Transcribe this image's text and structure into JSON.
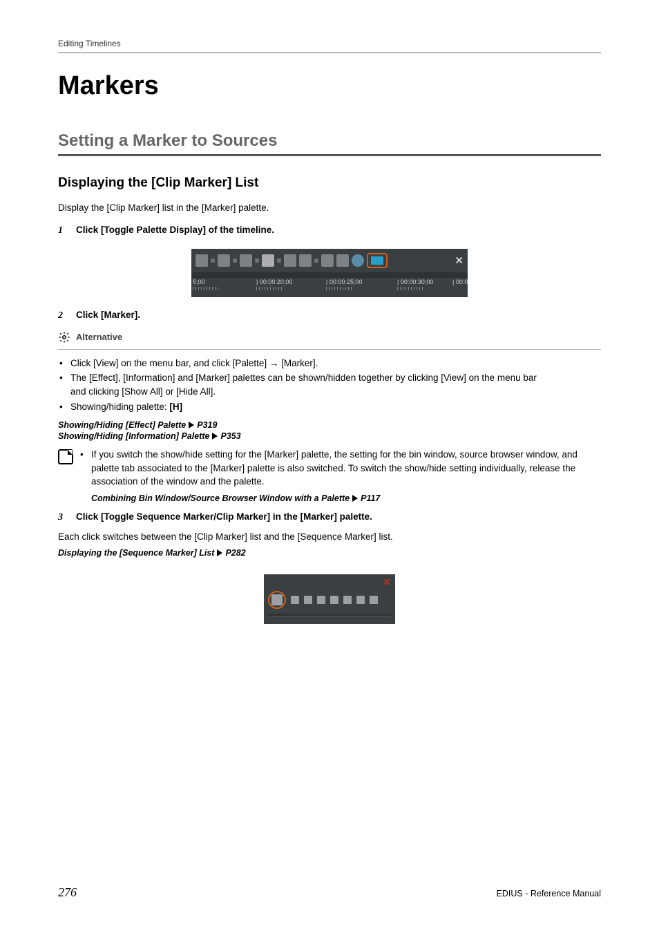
{
  "header": {
    "running": "Editing Timelines"
  },
  "h1": "Markers",
  "h2": "Setting a Marker to Sources",
  "h3": "Displaying the [Clip Marker] List",
  "intro": "Display the [Clip Marker] list in the [Marker] palette.",
  "steps": {
    "1": {
      "num": "1",
      "text": "Click [Toggle Palette Display] of the timeline."
    },
    "2": {
      "num": "2",
      "text": "Click [Marker]."
    },
    "3": {
      "num": "3",
      "text": "Click [Toggle Sequence Marker/Clip Marker] in the [Marker] palette."
    }
  },
  "fig_timeline": {
    "ticks": [
      "5;00",
      "| 00:00:20;00",
      "| 00:00:25;00",
      "| 00:00:30;00",
      "| 00:0"
    ],
    "close": "✕"
  },
  "alt": {
    "label": "Alternative"
  },
  "bullets": {
    "b1a": "Click [View] on the menu bar, and click [Palette] ",
    "b1arrow": "→",
    "b1b": " [Marker].",
    "b2a": "The [Effect], [Information] and [Marker] palettes can be shown/hidden together by clicking [View] on the menu bar ",
    "b2b": "and clicking [Show All] or [Hide All].",
    "b3a": "Showing/hiding palette: ",
    "b3key": "[H]"
  },
  "refs": {
    "r1_text": "Showing/Hiding [Effect] Palette",
    "r1_page": " P319",
    "r2_text": "Showing/Hiding [Information] Palette",
    "r2_page": " P353",
    "r3_text": "Combining Bin Window/Source Browser Window with a Palette",
    "r3_page": " P117",
    "r4_text": "Displaying the [Sequence Marker] List",
    "r4_page": " P282"
  },
  "note": {
    "text1": "If you switch the show/hide setting for the [Marker] palette, the setting for the bin window, source browser ",
    "text2": "window, and palette tab associated to the [Marker] palette is also switched. To switch the show/hide setting ",
    "text3": "individually, release the association of the window and the palette."
  },
  "after_step3": "Each click switches between the [Clip Marker] list and the [Sequence Marker] list.",
  "fig_palette": {
    "close": "✕"
  },
  "footer": {
    "page": "276",
    "manual": "EDIUS - Reference Manual"
  }
}
